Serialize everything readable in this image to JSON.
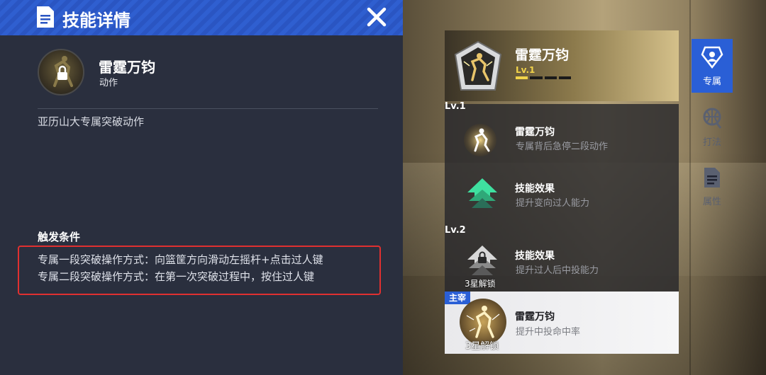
{
  "detail": {
    "title": "技能详情",
    "skill_name": "雷霆万钧",
    "skill_type": "动作",
    "description": "亚历山大专属突破动作",
    "trigger_title": "触发条件",
    "trigger_lines": [
      "专属一段突破操作方式：向篮筐方向滑动左摇杆+点击过人键",
      "专属二段突破操作方式：在第一次突破过程中，按住过人键"
    ]
  },
  "skill_header": {
    "name": "雷霆万钧",
    "level": "Lv.1",
    "level_progress": 0.25
  },
  "levels": [
    {
      "label": "Lv.1",
      "items": [
        {
          "title": "雷霆万钧",
          "subtitle": "专属背后急停二段动作",
          "icon": "dunk-player-icon"
        },
        {
          "title": "技能效果",
          "subtitle": "提升变向过人能力",
          "icon": "upgrade-arrow-icon"
        }
      ]
    },
    {
      "label": "Lv.2",
      "items": [
        {
          "title": "技能效果",
          "subtitle": "提升过人后中投能力",
          "icon": "locked-arrow-icon",
          "lock_text": "3星解锁"
        }
      ]
    }
  ],
  "main_skill": {
    "tag": "主宰",
    "title": "雷霆万钧",
    "subtitle": "提升中投命中率",
    "lock_text": "3星解锁"
  },
  "side_nav": [
    {
      "label": "专属",
      "icon": "exclusive-icon",
      "active": true
    },
    {
      "label": "打法",
      "icon": "playstyle-icon",
      "active": false
    },
    {
      "label": "属性",
      "icon": "attributes-icon",
      "active": false
    }
  ],
  "colors": {
    "accent_blue": "#2a5fd6",
    "level_gold": "#f1d34a",
    "highlight_red": "#e03030"
  }
}
